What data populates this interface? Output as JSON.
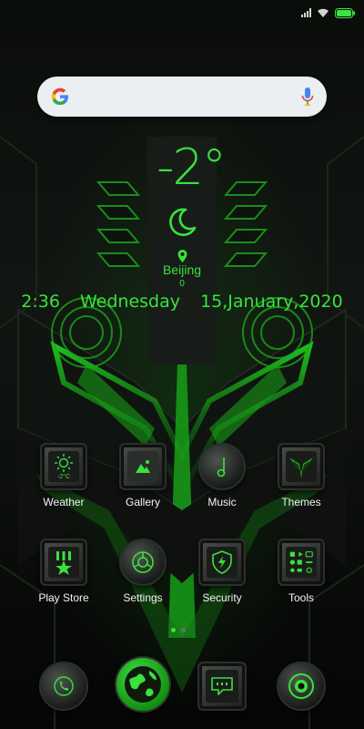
{
  "status": {
    "battery_icon": "battery-icon",
    "wifi_icon": "wifi-icon",
    "signal_icon": "signal-icon"
  },
  "search": {
    "logo": "google-g-icon",
    "mic": "mic-icon"
  },
  "weather": {
    "temperature": "-2°",
    "condition_icon": "moon-icon",
    "city": "Beijing",
    "aqi": "0"
  },
  "clock": {
    "time": "2:36",
    "day": "Wednesday",
    "date": "15,January,2020"
  },
  "apps": [
    {
      "label": "Weather",
      "icon": "sun-icon",
      "sub": "-2°C"
    },
    {
      "label": "Gallery",
      "icon": "image-icon"
    },
    {
      "label": "Music",
      "icon": "music-note-icon"
    },
    {
      "label": "Themes",
      "icon": "themes-icon"
    },
    {
      "label": "Play Store",
      "icon": "play-store-icon"
    },
    {
      "label": "Settings",
      "icon": "settings-icon"
    },
    {
      "label": "Security",
      "icon": "shield-icon"
    },
    {
      "label": "Tools",
      "icon": "tools-icon"
    }
  ],
  "pages": {
    "count": 2,
    "active": 1
  },
  "dock": [
    {
      "icon": "phone-icon"
    },
    {
      "icon": "browser-globe-icon"
    },
    {
      "icon": "messages-icon"
    },
    {
      "icon": "camera-icon"
    }
  ],
  "colors": {
    "accent": "#39e23d",
    "label": "#f2f2f2",
    "search_bg": "#eceff1"
  }
}
